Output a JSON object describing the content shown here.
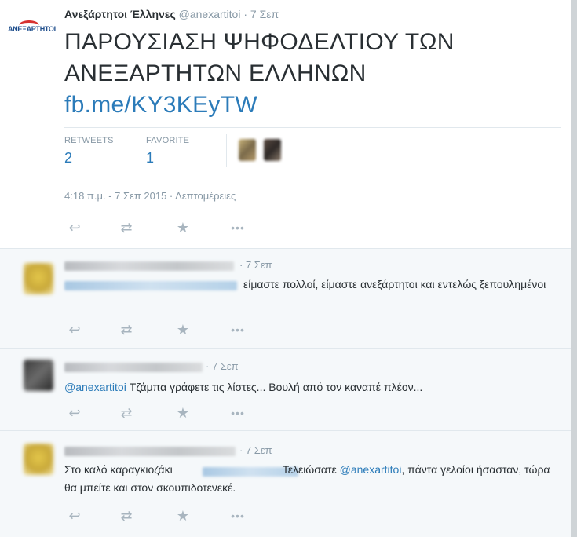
{
  "colors": {
    "link": "#2b7bb9",
    "muted": "#8899a6",
    "text": "#292f33",
    "reply_bg": "#f5f8fa"
  },
  "logo": {
    "text": "ΑΝΕΞΑΡΤΗΤΟΙ"
  },
  "tweet": {
    "author_name": "Ανεξάρτητοι Έλληνες",
    "author_handle": "@anexartitoi",
    "separator": "·",
    "time": "7 Σεπ",
    "text": "ΠΑΡΟΥΣΙΑΣΗ ΨΗΦΟΔΕΛΤΙΟΥ ΤΩΝ ΑΝΕΞΑΡΤΗΤΩΝ ΕΛΛΗΝΩΝ ",
    "link": "fb.me/KY3KEyTW",
    "retweets_label": "RETWEETS",
    "retweets_count": "2",
    "favorite_label": "FAVORITE",
    "favorite_count": "1",
    "timestamp": "4:18 π.μ. - 7 Σεπ 2015 · Λεπτομέρειες"
  },
  "actions": {
    "reply": "reply-icon",
    "retweet": "retweet-icon",
    "favorite": "star-icon",
    "more": "more-icon"
  },
  "replies": [
    {
      "time": "· 7 Σεπ",
      "text": "είμαστε πολλοί, είμαστε ανεξάρτητοι και εντελώς ξεπουλημένοι"
    },
    {
      "time": "· 7 Σεπ",
      "mention": "@anexartitoi",
      "text": " Τζάμπα γράφετε τις λίστες... Βουλή από τον καναπέ πλέον..."
    },
    {
      "time": "· 7 Σεπ",
      "text_before": "Στο καλό καραγκιοζάκι",
      "text_mid": "Τελειώσατε ",
      "mention": "@anexartitoi",
      "text_after": ", πάντα γελοίοι ήσασταν, τώρα  θα μπείτε και στον σκουπιδοτενεκέ."
    }
  ]
}
